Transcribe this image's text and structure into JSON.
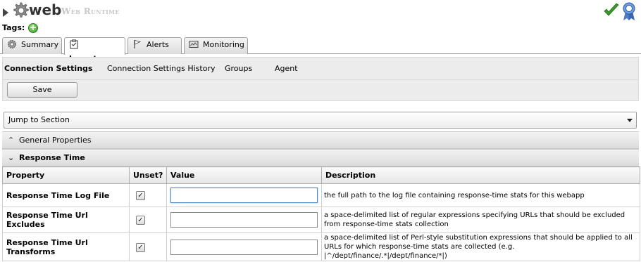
{
  "header": {
    "resource_name": "web",
    "resource_type": "Web Runtime",
    "tags_label": "Tags:"
  },
  "tabs": [
    {
      "label": "Summary",
      "icon": "gear-icon"
    },
    {
      "label": "Inventory",
      "icon": "clipboard-icon",
      "active": true
    },
    {
      "label": "Alerts",
      "icon": "flag-icon"
    },
    {
      "label": "Monitoring",
      "icon": "monitor-icon"
    }
  ],
  "subnav": {
    "items": [
      "Connection Settings",
      "Connection Settings History",
      "Groups",
      "Agent"
    ]
  },
  "toolbar": {
    "save_label": "Save"
  },
  "jump": {
    "label": "Jump to Section"
  },
  "sections": {
    "general": "General Properties",
    "response": "Response Time"
  },
  "table": {
    "headers": [
      "Property",
      "Unset?",
      "Value",
      "Description"
    ],
    "rows": [
      {
        "property": "Response Time Log File",
        "unset": true,
        "value": "",
        "description": "the full path to the log file containing response-time stats for this webapp"
      },
      {
        "property": "Response Time Url Excludes",
        "unset": true,
        "value": "",
        "description": "a space-delimited list of regular expressions specifying URLs that should be excluded from response-time stats collection"
      },
      {
        "property": "Response Time Url Transforms",
        "unset": true,
        "value": "",
        "description": "a space-delimited list of Perl-style substitution expressions that should be applied to all URLs for which response-time stats are collected (e.g. |^/dept/finance/.*|/dept/finance/*|)"
      }
    ]
  },
  "colors": {
    "availability": "#3a9a2a",
    "accent": "#4a8dc8"
  }
}
